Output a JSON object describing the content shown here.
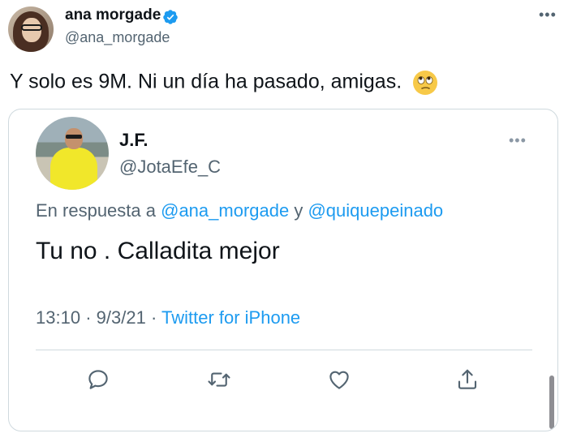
{
  "tweet": {
    "author": {
      "name": "ana morgade",
      "handle": "@ana_morgade",
      "verified": true,
      "avatar_icon": "profile-photo-woman-glasses"
    },
    "text": "Y solo es 9M. Ni un día ha pasado, amigas.",
    "emoji": "🙄",
    "more_icon": "more-horizontal-icon"
  },
  "quoted": {
    "author": {
      "name": "J.F.",
      "handle": "@JotaEfe_C",
      "avatar_icon": "profile-photo-man-yellow-shirt"
    },
    "reply_prefix": "En respuesta a",
    "reply_to_1": "@ana_morgade",
    "reply_connector": "y",
    "reply_to_2": "@quiquepeinado",
    "text": "Tu no . Calladita mejor",
    "time": "13:10",
    "date": "9/3/21",
    "separator": "·",
    "source": "Twitter for iPhone",
    "actions": [
      {
        "name": "reply",
        "icon": "reply-icon"
      },
      {
        "name": "retweet",
        "icon": "retweet-icon"
      },
      {
        "name": "like",
        "icon": "heart-icon"
      },
      {
        "name": "share",
        "icon": "share-icon"
      }
    ]
  },
  "colors": {
    "text_primary": "#0f1419",
    "text_secondary": "#536471",
    "link": "#1d9bf0",
    "border": "#cfd9de",
    "verified": "#1d9bf0"
  }
}
